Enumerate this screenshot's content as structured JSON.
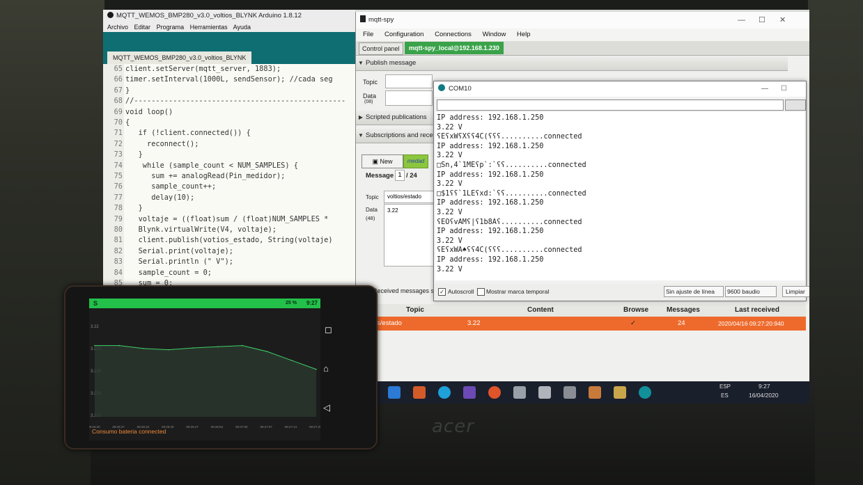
{
  "arduino": {
    "title": "MQTT_WEMOS_BMP280_v3.0_voltios_BLYNK Arduino 1.8.12",
    "menu": [
      "Archivo",
      "Editar",
      "Programa",
      "Herramientas",
      "Ayuda"
    ],
    "tab": "MQTT_WEMOS_BMP280_v3.0_voltios_BLYNK",
    "code": [
      {
        "ln": "65",
        "text": "client.setServer(mqtt_server, 1883);"
      },
      {
        "ln": "66",
        "text": "timer.setInterval(1000L, sendSensor); //cada seg"
      },
      {
        "ln": "67",
        "text": "}"
      },
      {
        "ln": "68",
        "text": "//-------------------------------------------------"
      },
      {
        "ln": "69",
        "text": "void loop()"
      },
      {
        "ln": "70",
        "text": "{"
      },
      {
        "ln": "71",
        "text": "   if (!client.connected()) {"
      },
      {
        "ln": "72",
        "text": "     reconnect();"
      },
      {
        "ln": "73",
        "text": "   }"
      },
      {
        "ln": "74",
        "text": "    while (sample_count < NUM_SAMPLES) {"
      },
      {
        "ln": "75",
        "text": "      sum += analogRead(Pin_medidor);"
      },
      {
        "ln": "76",
        "text": "      sample_count++;"
      },
      {
        "ln": "77",
        "text": "      delay(10);"
      },
      {
        "ln": "78",
        "text": "   }"
      },
      {
        "ln": "79",
        "text": "   voltaje = ((float)sum / (float)NUM_SAMPLES *"
      },
      {
        "ln": "80",
        "text": "   Blynk.virtualWrite(V4, voltaje);"
      },
      {
        "ln": "81",
        "text": "   client.publish(votios_estado, String(voltaje)"
      },
      {
        "ln": "82",
        "text": "   Serial.print(voltaje);"
      },
      {
        "ln": "83",
        "text": "   Serial.println (\" V\");"
      },
      {
        "ln": "84",
        "text": "   sample_count = 0;"
      },
      {
        "ln": "85",
        "text": "   sum = 0;"
      }
    ]
  },
  "spy": {
    "title": "mqtt-spy",
    "menu": [
      "File",
      "Configuration",
      "Connections",
      "Window",
      "Help"
    ],
    "tab_control": "Control panel",
    "tab_connection": "mqtt-spy_local@192.168.1.230",
    "publish_header": "Publish message",
    "topic_label": "Topic",
    "data_label": "Data",
    "data_hint": "(08)",
    "scripted_header": "Scripted publications",
    "subs_header": "Subscriptions and rece",
    "new_button": "New",
    "medad_button": "medad",
    "message_label": "Message",
    "message_index": "1",
    "message_total": "/ 24",
    "msg_topic_label": "Topic",
    "msg_topic_value": "voltios/estado",
    "msg_data_label": "Data",
    "msg_data_hint": "(48)",
    "msg_data_value": "3.22",
    "received_label": "Received messages su",
    "table_headers": [
      "Topic",
      "Content",
      "Browse",
      "Messages",
      "Last received"
    ],
    "row": {
      "topic": "tios/estado",
      "content": "3.22",
      "browse": "✓",
      "messages": "24",
      "last": "2020/04/16 09:27:20:940"
    }
  },
  "com": {
    "title": "COM10",
    "lines": [
      "IP address: 192.168.1.250",
      "3.22 V",
      "ʕEʕxWʕXʕʕ4C(ʕʕʕ..........connected",
      "IP address: 192.168.1.250",
      "3.22 V",
      "□Sn,4`1MEʕp`:`ʕʕ..........connected",
      "IP address: 192.168.1.250",
      "3.22 V",
      "□$1ʕʕ`1LEʕxd:`ʕʕ..........connected",
      "IP address: 192.168.1.250",
      "3.22 V",
      "ʕEOʕvAMʕ|ʕ1b8Aʕ..........connected",
      "IP address: 192.168.1.250",
      "3.22 V",
      "ʕEʕxWA♠ʕʕ4C(ʕʕʕ..........connected",
      "IP address: 192.168.1.250",
      "3.22 V"
    ],
    "autoscroll": "Autoscroll",
    "timestamp": "Mostrar marca temporal",
    "line_ending": "Sin ajuste de línea",
    "baud": "9600 baudio",
    "clear": "Limpiar"
  },
  "taskbar": {
    "lang": "ESP",
    "lang2": "ES",
    "time": "9:27",
    "date": "16/04/2020"
  },
  "phone": {
    "status_time": "9:27",
    "status_battery": "25 %",
    "app_letter": "S",
    "consumo": "Consumo bateria connected",
    "chart_data": {
      "type": "line",
      "x": [
        "09:26:20",
        "09:26:27",
        "09:26:34",
        "09:26:40",
        "09:26:47",
        "09:26:54",
        "09:27:00",
        "09:27:07",
        "09:27:14",
        "09:27:20"
      ],
      "series": [
        {
          "values": [
            3.222,
            3.222,
            3.2215,
            3.2213,
            3.2216,
            3.2218,
            3.222,
            3.221,
            3.2195,
            3.218
          ]
        }
      ],
      "yticks": [
        "3.22",
        "3.221",
        "3.220",
        "3.215",
        "3.211"
      ],
      "ylim": [
        3.21,
        3.225
      ]
    }
  },
  "brand": "acer"
}
